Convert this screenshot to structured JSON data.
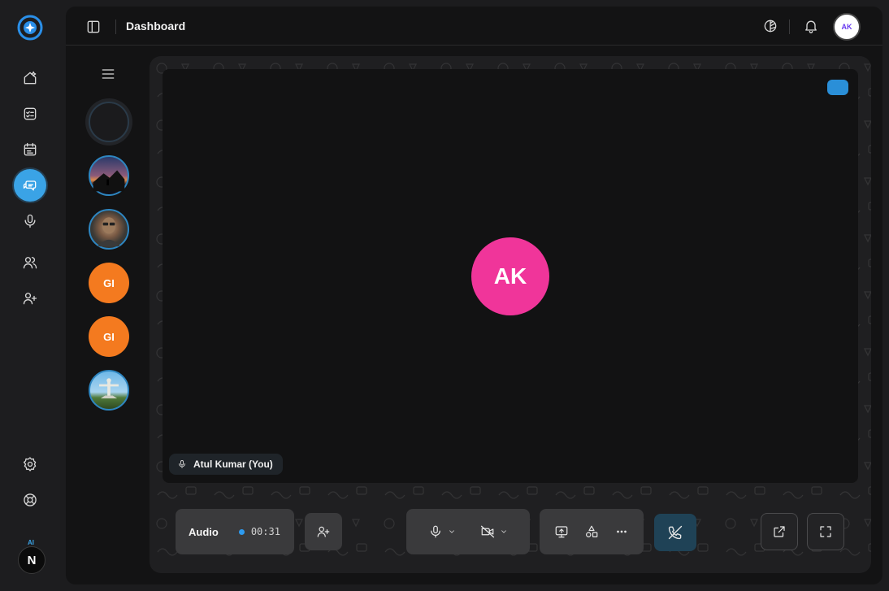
{
  "topbar": {
    "title": "Dashboard",
    "avatar_text": "AK"
  },
  "rail": {
    "user_initial": "N",
    "ai_badge": "AI"
  },
  "chats": [
    {
      "kind": "empty"
    },
    {
      "kind": "photo",
      "icon": "mountain-photo"
    },
    {
      "kind": "photo",
      "icon": "person-photo"
    },
    {
      "kind": "initials",
      "initials": "GI"
    },
    {
      "kind": "initials",
      "initials": "GI"
    },
    {
      "kind": "photo",
      "icon": "statue-photo"
    }
  ],
  "call": {
    "participant_initials": "AK",
    "participant_color": "#f0359a",
    "self_label": "Atul Kumar (You)",
    "mode_label": "Audio",
    "elapsed": "00:31"
  },
  "colors": {
    "accent": "#3aa3e6",
    "orange": "#f47a1f",
    "end_call": "#1f4256"
  }
}
